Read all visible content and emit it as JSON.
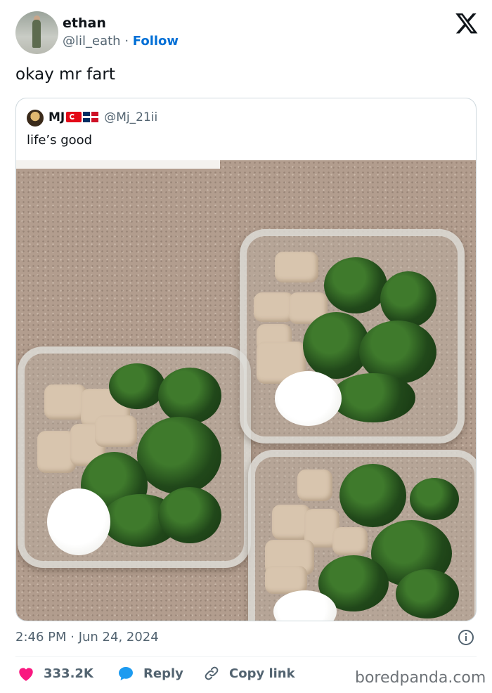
{
  "author": {
    "name": "ethan",
    "handle": "@lil_eath",
    "separator": "·",
    "follow_label": "Follow"
  },
  "tweet": {
    "text": "okay mr fart"
  },
  "quoted": {
    "name": "MJ",
    "handle": "@Mj_21ii",
    "text": "life’s good"
  },
  "meta": {
    "timestamp": "2:46 PM · Jun 24, 2024"
  },
  "actions": {
    "like_count": "333.2K",
    "reply_label": "Reply",
    "copy_label": "Copy link"
  },
  "watermark": "boredpanda.com",
  "colors": {
    "like": "#f91880",
    "reply": "#1d9bf0",
    "follow": "#006fd6"
  }
}
